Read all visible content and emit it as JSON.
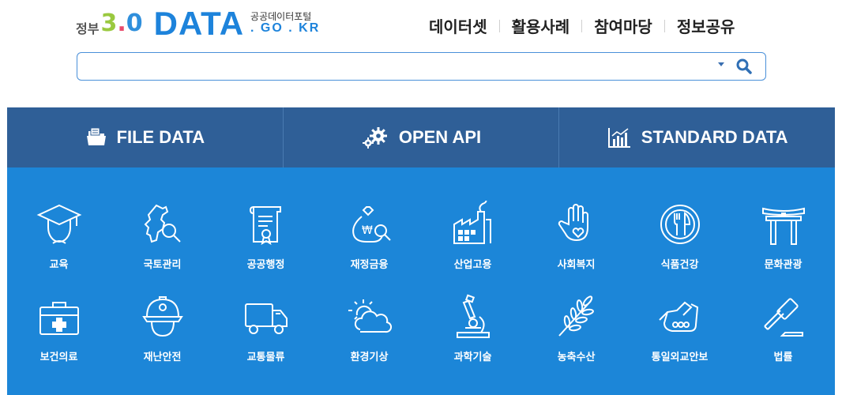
{
  "logo": {
    "gov": "정부",
    "version_main": "3",
    "version_dot": ".",
    "version_minor": "0",
    "brand": "DATA",
    "portal_name": "공공데이터포털",
    "domain": ". GO . KR"
  },
  "topnav": [
    "데이터셋",
    "활용사례",
    "참여마당",
    "정보공유"
  ],
  "search": {
    "value": "",
    "placeholder": ""
  },
  "tabs": [
    {
      "label": "FILE DATA",
      "icon": "file-data-icon"
    },
    {
      "label": "OPEN API",
      "icon": "gears-icon"
    },
    {
      "label": "STANDARD DATA",
      "icon": "bar-chart-icon"
    }
  ],
  "categories": [
    {
      "label": "교육",
      "icon": "graduation-cap-icon"
    },
    {
      "label": "국토관리",
      "icon": "map-search-icon"
    },
    {
      "label": "공공행정",
      "icon": "certificate-scroll-icon"
    },
    {
      "label": "재정금융",
      "icon": "money-bag-icon"
    },
    {
      "label": "산업고용",
      "icon": "factory-icon"
    },
    {
      "label": "사회복지",
      "icon": "hand-heart-icon"
    },
    {
      "label": "식품건강",
      "icon": "fork-knife-plate-icon"
    },
    {
      "label": "문화관광",
      "icon": "torii-gate-icon"
    },
    {
      "label": "보건의료",
      "icon": "first-aid-kit-icon"
    },
    {
      "label": "재난안전",
      "icon": "firefighter-helmet-icon"
    },
    {
      "label": "교통물류",
      "icon": "delivery-truck-icon"
    },
    {
      "label": "환경기상",
      "icon": "sun-cloud-icon"
    },
    {
      "label": "과학기술",
      "icon": "microscope-icon"
    },
    {
      "label": "농축수산",
      "icon": "wheat-icon"
    },
    {
      "label": "통일외교안보",
      "icon": "handshake-icon"
    },
    {
      "label": "법률",
      "icon": "gavel-icon"
    }
  ],
  "colors": {
    "brand_blue": "#1d83db",
    "tab_bar": "#2f5f97",
    "panel": "#1c86d8"
  }
}
